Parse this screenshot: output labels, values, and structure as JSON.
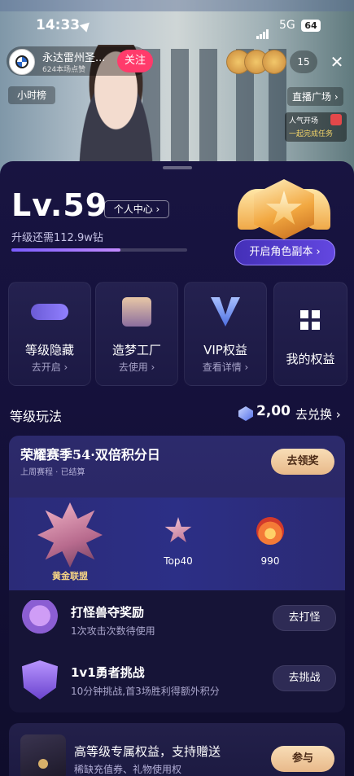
{
  "status_bar": {
    "time": "14:33",
    "network": "5G",
    "battery": "64"
  },
  "live": {
    "host_name": "永达雷州圣...",
    "host_likes": "624本场点赞",
    "follow_label": "关注",
    "viewer_count": "15",
    "hour_rank_label": "小时榜",
    "live_square_label": "直播广场 ›",
    "task_title": "人气开场",
    "task_sub": "一起完成任务"
  },
  "level": {
    "title": "Lv.59",
    "center_label": "个人中心 ›",
    "upgrade_text": "升级还需112.9w钻",
    "progress": 0.62,
    "role_button": "开启角色副本 ›"
  },
  "tiles": [
    {
      "title": "等级隐藏",
      "sub": "去开启 ›"
    },
    {
      "title": "造梦工厂",
      "sub": "去使用 ›"
    },
    {
      "title": "VIP权益",
      "sub": "查看详情 ›"
    },
    {
      "title": "我的权益",
      "sub": ""
    }
  ],
  "section": {
    "title": "等级玩法",
    "gem_count": "2,00",
    "exchange_label": "去兑换 ›"
  },
  "season": {
    "title": "荣耀赛季54·双倍积分日",
    "subtitle": "上周赛程 · 已结算",
    "claim_label": "去领奖",
    "league_label": "黄金联盟",
    "rank_label": "Top40",
    "score_label": "990"
  },
  "tasks": [
    {
      "title": "打怪兽夺奖励",
      "desc": "1次攻击次数待使用",
      "button": "去打怪"
    },
    {
      "title": "1v1勇者挑战",
      "desc": "10分钟挑战,首3场胜利得额外积分",
      "button": "去挑战"
    }
  ],
  "privilege": {
    "title": "高等级专属权益，支持赠送",
    "sub": "稀缺充值券、礼物使用权",
    "button": "参与"
  }
}
